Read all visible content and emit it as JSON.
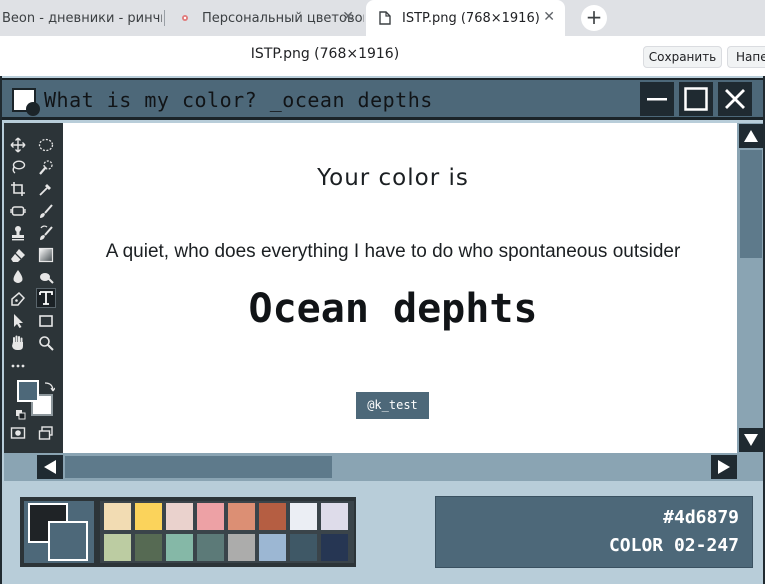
{
  "browser": {
    "tabs": [
      {
        "title": "Beon - дневники - ринчик",
        "active": false
      },
      {
        "title": "Персональный цветовой т",
        "active": false
      },
      {
        "title": "ISTP.png (768×1916)",
        "active": true
      }
    ],
    "new_tab_icon": "plus-icon",
    "close_icon": "close-icon"
  },
  "viewer": {
    "file_title": "ISTP.png (768×1916)",
    "save_label": "Сохранить",
    "print_label": "Напе"
  },
  "window": {
    "title": "What is my color? _ocean depths",
    "buttons": [
      "minimize-icon",
      "maximize-icon",
      "close-icon"
    ]
  },
  "tools": [
    "move",
    "lasso-select",
    "magic-wand",
    "brush-select",
    "crop",
    "eyedropper",
    "frame",
    "brush",
    "stamp",
    "healing",
    "eraser",
    "gradient",
    "blur",
    "smudge",
    "pen",
    "type",
    "path-select",
    "rectangle",
    "hand",
    "zoom",
    "more",
    "swap-colors",
    "screen-mode",
    "artboard"
  ],
  "content": {
    "heading": "Your color is",
    "description": "A quiet, who does everything I have to do who spontaneous outsider",
    "color_name": "Ocean dephts",
    "tag": "@k_test"
  },
  "palette": {
    "foreground": "#1f2326",
    "background": "#4d6879",
    "swatches": [
      "#f2dcb3",
      "#fbd35b",
      "#ead2cd",
      "#eda1a5",
      "#dc8f74",
      "#b55e42",
      "#ebeef4",
      "#dedcea",
      "#bccca2",
      "#566a53",
      "#85b8a7",
      "#5c7a78",
      "#acacab",
      "#9cb7d3",
      "#3f5866",
      "#263653"
    ]
  },
  "info": {
    "hex": "#4d6879",
    "color_code": "COLOR 02-247"
  },
  "colors": {
    "accent": "#4d6879",
    "window_bg": "#b8cdd9",
    "scrollbar": "#8aa4b3",
    "dark": "#1f2a31"
  }
}
